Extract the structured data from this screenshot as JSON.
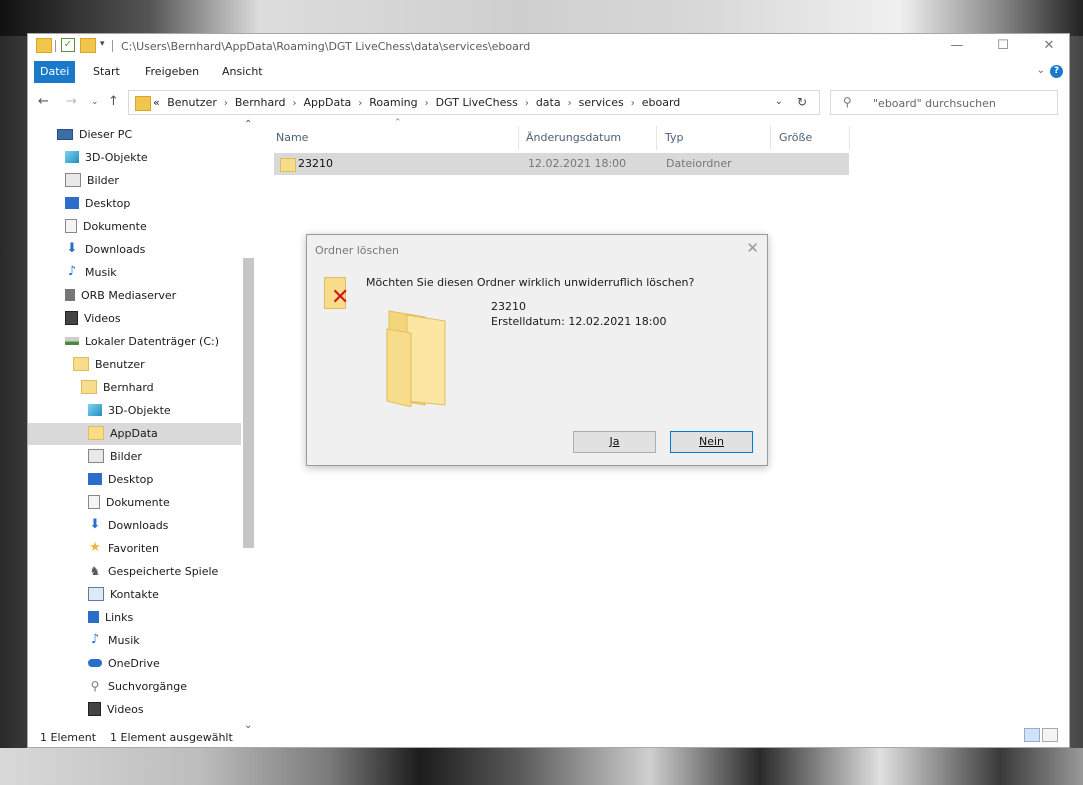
{
  "window": {
    "title": "C:\\Users\\Bernhard\\AppData\\Roaming\\DGT LiveChess\\data\\services\\eboard",
    "minimize": "—",
    "maximize": "☐",
    "close": "✕"
  },
  "ribbon": {
    "tabs": [
      "Datei",
      "Start",
      "Freigeben",
      "Ansicht"
    ],
    "help": "?"
  },
  "address": {
    "prefix": "«",
    "crumbs": [
      "Benutzer",
      "Bernhard",
      "AppData",
      "Roaming",
      "DGT LiveChess",
      "data",
      "services",
      "eboard"
    ]
  },
  "search": {
    "placeholder": "\"eboard\" durchsuchen"
  },
  "nav": {
    "items": [
      {
        "label": "Dieser PC",
        "icon": "computer-icon"
      },
      {
        "label": "3D-Objekte",
        "icon": "3d-objects-icon"
      },
      {
        "label": "Bilder",
        "icon": "pictures-icon"
      },
      {
        "label": "Desktop",
        "icon": "desktop-icon"
      },
      {
        "label": "Dokumente",
        "icon": "documents-icon"
      },
      {
        "label": "Downloads",
        "icon": "downloads-icon"
      },
      {
        "label": "Musik",
        "icon": "music-icon"
      },
      {
        "label": "ORB Mediaserver",
        "icon": "media-server-icon"
      },
      {
        "label": "Videos",
        "icon": "videos-icon"
      },
      {
        "label": "Lokaler Datenträger (C:)",
        "icon": "drive-icon"
      },
      {
        "label": "Benutzer",
        "icon": "folder-icon"
      },
      {
        "label": "Bernhard",
        "icon": "folder-icon"
      },
      {
        "label": "3D-Objekte",
        "icon": "3d-objects-icon"
      },
      {
        "label": "AppData",
        "icon": "folder-icon"
      },
      {
        "label": "Bilder",
        "icon": "pictures-icon"
      },
      {
        "label": "Desktop",
        "icon": "desktop-icon"
      },
      {
        "label": "Dokumente",
        "icon": "documents-icon"
      },
      {
        "label": "Downloads",
        "icon": "downloads-icon"
      },
      {
        "label": "Favoriten",
        "icon": "star-icon"
      },
      {
        "label": "Gespeicherte Spiele",
        "icon": "saved-games-icon"
      },
      {
        "label": "Kontakte",
        "icon": "contacts-icon"
      },
      {
        "label": "Links",
        "icon": "links-icon"
      },
      {
        "label": "Musik",
        "icon": "music-icon"
      },
      {
        "label": "OneDrive",
        "icon": "cloud-icon"
      },
      {
        "label": "Suchvorgänge",
        "icon": "search-icon"
      },
      {
        "label": "Videos",
        "icon": "videos-icon"
      }
    ]
  },
  "columns": [
    "Name",
    "Änderungsdatum",
    "Typ",
    "Größe"
  ],
  "files": [
    {
      "name": "23210",
      "date": "12.02.2021 18:00",
      "type": "Dateiordner",
      "size": ""
    }
  ],
  "status": {
    "count": "1 Element",
    "selected": "1 Element ausgewählt"
  },
  "dialog": {
    "title": "Ordner löschen",
    "question": "Möchten Sie diesen Ordner wirklich unwiderruflich löschen?",
    "name": "23210",
    "created": "Erstelldatum: 12.02.2021 18:00",
    "yes": "Ja",
    "no": "Nein",
    "close": "✕"
  },
  "colors": {
    "accent": "#1979ca",
    "selection": "#d9d9d9",
    "folder": "#f7dc8c"
  }
}
